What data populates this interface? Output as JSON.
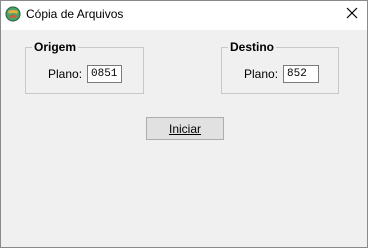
{
  "window": {
    "title": "Cópia de Arquivos",
    "icon": "app-globe-icon",
    "close_icon": "close-icon"
  },
  "origem": {
    "legend": "Origem",
    "plano_label": "Plano:",
    "plano_value": "0851"
  },
  "destino": {
    "legend": "Destino",
    "plano_label": "Plano:",
    "plano_value": "852"
  },
  "actions": {
    "iniciar_label": "Iniciar"
  },
  "colors": {
    "client_background": "#f0f0f0",
    "button_background": "#e1e1e1"
  }
}
